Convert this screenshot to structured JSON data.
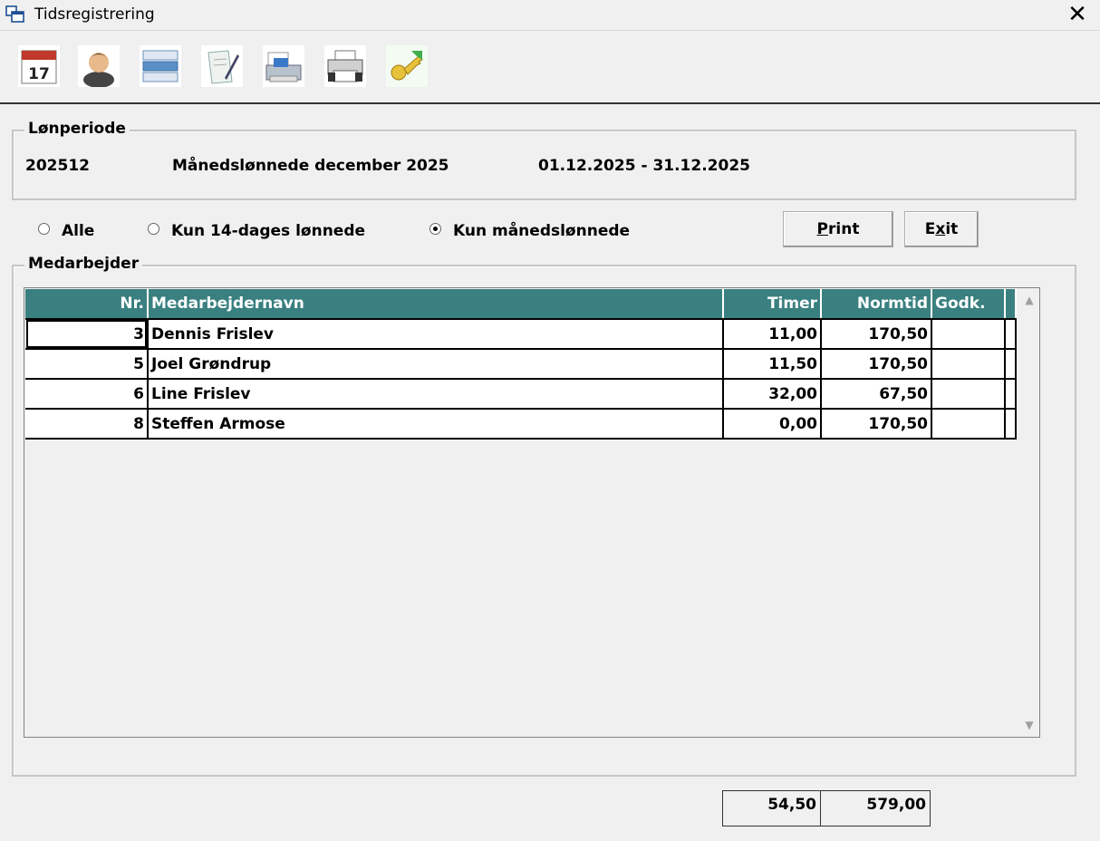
{
  "window": {
    "title": "Tidsregistrering",
    "close_glyph": "✕"
  },
  "toolbar": {
    "buttons": [
      {
        "name": "calendar-icon",
        "label": "17"
      },
      {
        "name": "person-icon",
        "label": ""
      },
      {
        "name": "items-list-icon",
        "label": ""
      },
      {
        "name": "document-edit-icon",
        "label": ""
      },
      {
        "name": "scanner-icon",
        "label": ""
      },
      {
        "name": "printer-icon",
        "label": ""
      },
      {
        "name": "key-icon",
        "label": ""
      }
    ]
  },
  "period": {
    "group_label": "Lønperiode",
    "code": "202512",
    "description": "Månedslønnede december 2025",
    "range": "01.12.2025 - 31.12.2025"
  },
  "filter": {
    "options": [
      {
        "label": "Alle",
        "selected": false
      },
      {
        "label": "Kun 14-dages lønnede",
        "selected": false
      },
      {
        "label": "Kun månedslønnede",
        "selected": true
      }
    ]
  },
  "actions": {
    "print": "Print",
    "exit": "Exit"
  },
  "employees": {
    "group_label": "Medarbejder",
    "columns": [
      "Nr.",
      "Medarbejdernavn",
      "Timer",
      "Normtid",
      "Godk."
    ],
    "rows": [
      {
        "nr": "3",
        "name": "Dennis Frislev",
        "timer": "11,00",
        "normtid": "170,50",
        "godk": ""
      },
      {
        "nr": "5",
        "name": "Joel Grøndrup",
        "timer": "11,50",
        "normtid": "170,50",
        "godk": ""
      },
      {
        "nr": "6",
        "name": "Line Frislev",
        "timer": "32,00",
        "normtid": "67,50",
        "godk": ""
      },
      {
        "nr": "8",
        "name": "Steffen Armose",
        "timer": "0,00",
        "normtid": "170,50",
        "godk": ""
      }
    ]
  },
  "totals": {
    "timer": "54,50",
    "normtid": "579,00"
  }
}
